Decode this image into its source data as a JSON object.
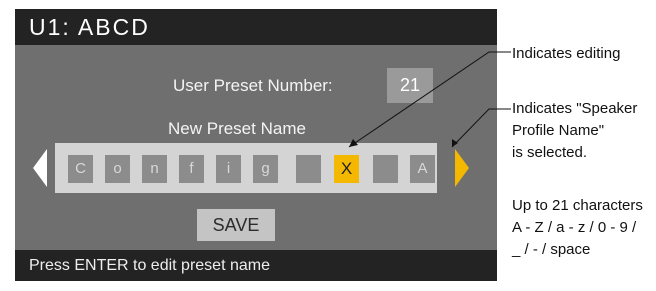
{
  "screen": {
    "title": "U1: ABCD",
    "preset_number_label": "User Preset Number:",
    "preset_number_value": "21",
    "new_name_label": "New Preset Name",
    "characters": [
      "C",
      "o",
      "n",
      "f",
      "i",
      "g",
      "",
      "X",
      "",
      "A"
    ],
    "active_character_index": 7,
    "save_label": "SAVE",
    "status_text": "Press ENTER to edit preset name"
  },
  "annotations": {
    "editing": "Indicates editing",
    "profile_lines": [
      "Indicates \"Speaker",
      "Profile Name\"",
      "is selected."
    ],
    "limits_lines": [
      "Up to 21 characters",
      "A - Z / a - z / 0 - 9 /",
      "_ / - / space"
    ]
  },
  "colors": {
    "screen_dark": "#232323",
    "panel_gray": "#6f6f6f",
    "highlight_yellow": "#f5b800",
    "strip_light": "#d4d4d4"
  }
}
